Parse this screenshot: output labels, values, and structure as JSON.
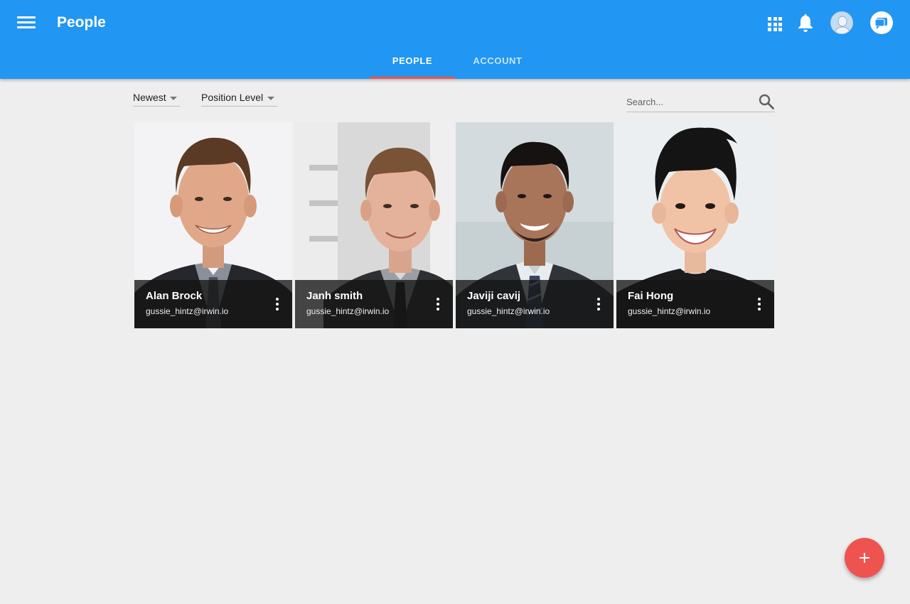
{
  "app": {
    "title": "People"
  },
  "header_icons": [
    "menu-icon",
    "apps-icon",
    "bell-icon",
    "user-avatar",
    "chat-icon"
  ],
  "tabs": [
    {
      "label": "PEOPLE",
      "active": true
    },
    {
      "label": "ACCOUNT",
      "active": false
    }
  ],
  "filters": {
    "sort": {
      "selected": "Newest"
    },
    "position": {
      "selected": "Position Level"
    }
  },
  "search": {
    "placeholder": "Search..."
  },
  "people": [
    {
      "name": "Alan Brock",
      "email": "gussie_hintz@irwin.io"
    },
    {
      "name": "Janh smith",
      "email": "gussie_hintz@irwin.io"
    },
    {
      "name": "Javiji cavij",
      "email": "gussie_hintz@irwin.io"
    },
    {
      "name": "Fai Hong",
      "email": "gussie_hintz@irwin.io"
    }
  ],
  "fab": {
    "icon": "plus-icon"
  },
  "colors": {
    "primary": "#2196f3",
    "accent": "#ef5350",
    "background": "#eeeeee"
  }
}
